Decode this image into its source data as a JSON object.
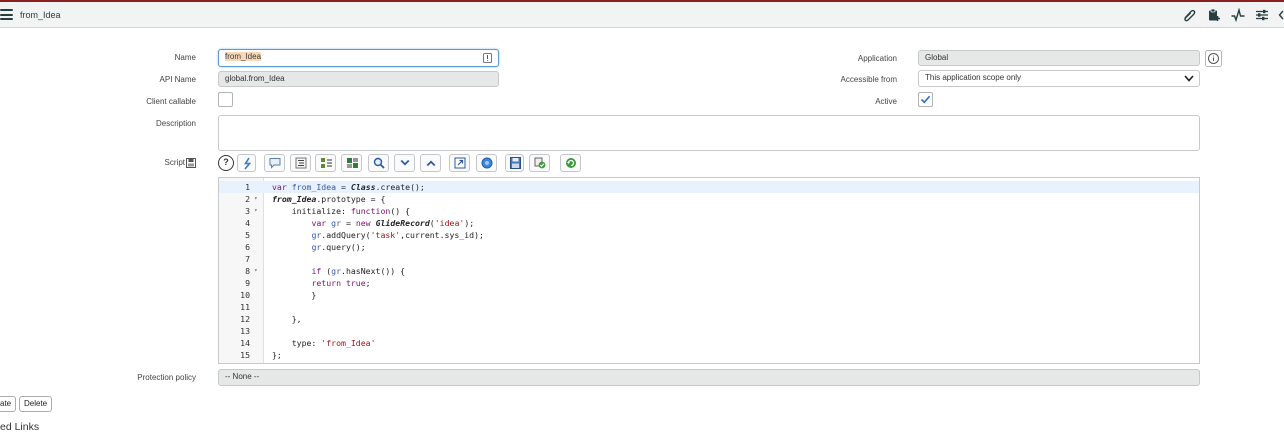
{
  "header": {
    "title": "from_Idea"
  },
  "form": {
    "name_label": "Name",
    "name_value": "from_Idea",
    "api_name_label": "API Name",
    "api_name_value": "global.from_Idea",
    "client_callable_label": "Client callable",
    "client_callable_checked": false,
    "description_label": "Description",
    "description_value": "",
    "application_label": "Application",
    "application_value": "Global",
    "accessible_from_label": "Accessible from",
    "accessible_from_value": "This application scope only",
    "active_label": "Active",
    "active_checked": true,
    "script_label": "Script",
    "protection_policy_label": "Protection policy",
    "protection_policy_value": "-- None --"
  },
  "toolbar": {
    "help": "?",
    "icons": [
      "help-icon",
      "toggle-syntax-icon",
      "comment-icon",
      "format-code-icon",
      "insert-field-icon",
      "script-debugger-icon",
      "search-icon",
      "find-next-icon",
      "find-previous-icon",
      "fullscreen-icon",
      "script-tree-icon",
      "save-icon",
      "check-syntax-icon",
      "restore-icon"
    ]
  },
  "code": {
    "line_numbers": [
      "1",
      "2",
      "3",
      "4",
      "5",
      "6",
      "7",
      "8",
      "9",
      "10",
      "11",
      "12",
      "13",
      "14",
      "15"
    ],
    "lines": [
      "var from_Idea = Class.create();",
      "from_Idea.prototype = {",
      "    initialize: function() {",
      "        var gr = new GlideRecord('idea');",
      "        gr.addQuery('task',current.sys_id);",
      "        gr.query();",
      "",
      "        if (gr.hasNext()) {",
      "        return true;",
      "        }",
      "",
      "    },",
      "",
      "    type: 'from_Idea'",
      "};"
    ]
  },
  "buttons": {
    "update": "ate",
    "delete": "Delete"
  },
  "related_links": "ed Links",
  "colors": {
    "top_border": "#8b1f1f",
    "active_check": "#2e6fd0",
    "focus_border": "#5b9bd5"
  }
}
